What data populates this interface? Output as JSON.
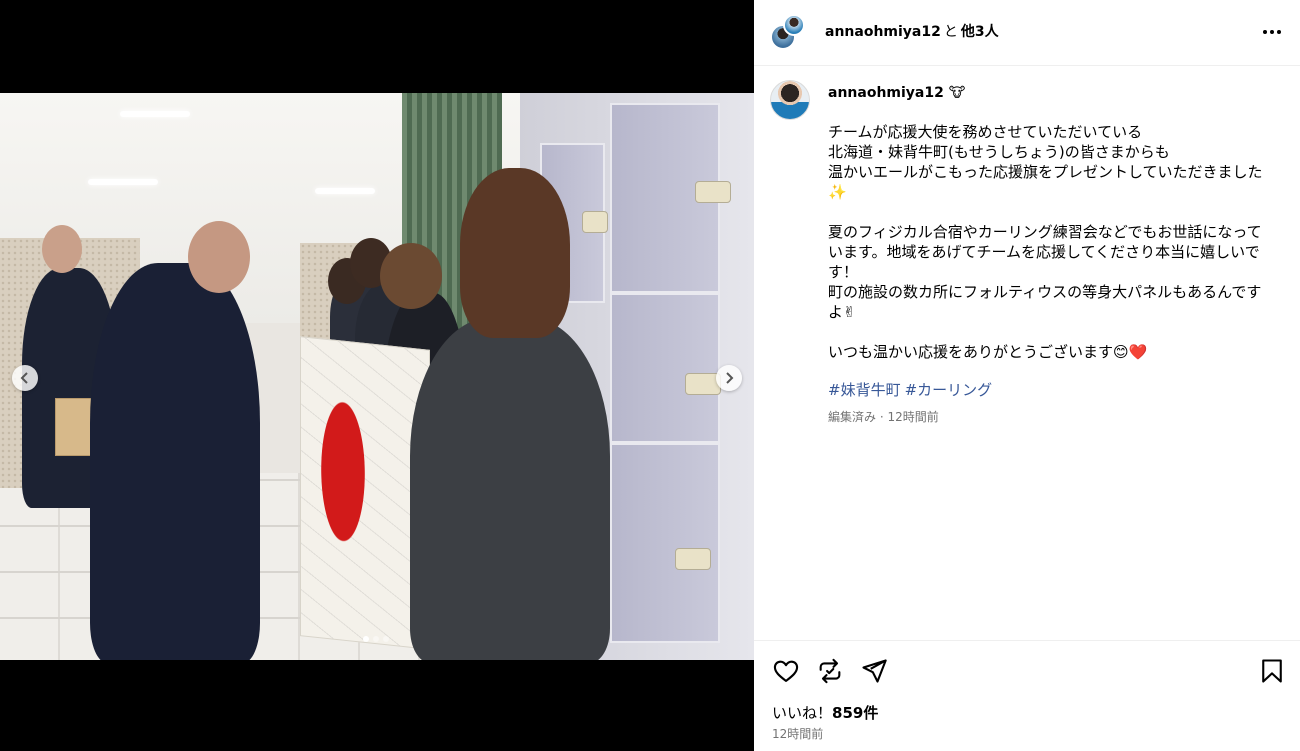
{
  "header": {
    "username": "annaohmiya12",
    "connector": "と",
    "others": "他3人"
  },
  "caption": {
    "username": "annaohmiya12",
    "username_emoji": "🐮",
    "text": "チームが応援大使を務めさせていただいている\n北海道・妹背牛町(もせうしちょう)の皆さまからも\n温かいエールがこもった応援旗をプレゼントしていただきました✨\n\n夏のフィジカル合宿やカーリング練習会などでもお世話になっています。地域をあげてチームを応援してくださり本当に嬉しいです！\n町の施設の数カ所にフォルティウスの等身大パネルもあるんですよ✌\n\nいつも温かい応援をありがとうございます😊❤️",
    "hashtags": [
      "#妹背牛町",
      "#カーリング"
    ],
    "meta": "編集済み · 12時間前"
  },
  "footer": {
    "likes_label": "いいね！",
    "likes_count": "859件",
    "time": "12時間前"
  },
  "carousel": {
    "dot_count": 3,
    "active_dot": 0
  },
  "icons": {
    "header_more": "more-horizontal-icon",
    "like": "heart-icon",
    "repost": "repost-icon",
    "share": "send-icon",
    "save": "bookmark-icon",
    "prev": "chevron-left-icon",
    "next": "chevron-right-icon"
  }
}
